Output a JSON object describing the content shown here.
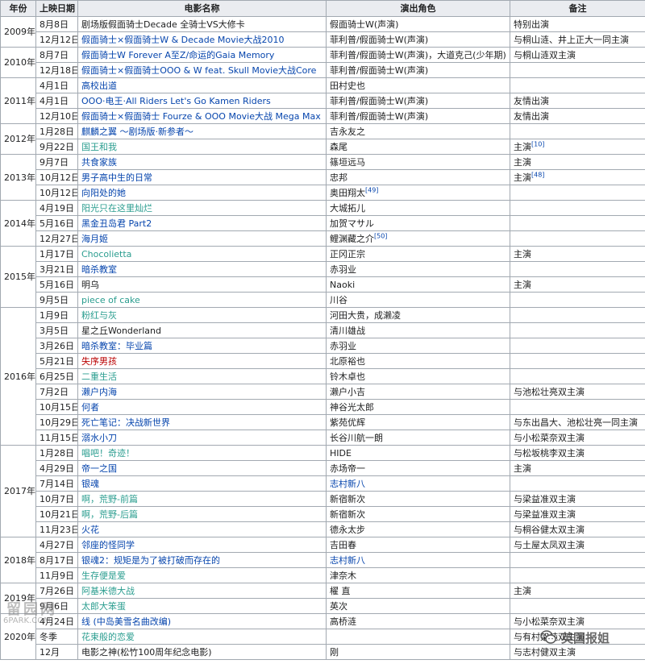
{
  "headers": [
    "年份",
    "上映日期",
    "电影名称",
    "演出角色",
    "备注"
  ],
  "years": [
    {
      "label": "2009年",
      "rows": [
        {
          "date": "8月8日",
          "title": "剧场版假面骑士Decade 全骑士VS大修卡",
          "title_style": "plain",
          "role": "假面骑士W(声演)",
          "note": "特别出演"
        },
        {
          "date": "12月12日",
          "title": "假面骑士×假面骑士W & Decade Movie大战2010",
          "title_style": "blue",
          "role": "菲利普/假面骑士W(声演)",
          "note": "与桐山涟、井上正大一同主演"
        }
      ]
    },
    {
      "label": "2010年",
      "rows": [
        {
          "date": "8月7日",
          "title": "假面骑士W Forever A至Z/命运的Gaia Memory",
          "title_style": "blue",
          "role": "菲利普/假面骑士W(声演)，大道克己(少年期)",
          "note": "与桐山涟双主演"
        },
        {
          "date": "12月18日",
          "title": "假面骑士×假面骑士OOO & W feat. Skull Movie大战Core",
          "title_style": "blue",
          "role": "菲利普/假面骑士W(声演)",
          "note": ""
        }
      ]
    },
    {
      "label": "2011年",
      "rows": [
        {
          "date": "4月1日",
          "title": "高校出道",
          "title_style": "blue",
          "role": "田村史也",
          "note": ""
        },
        {
          "date": "4月1日",
          "title": "OOO·电王·All Riders Let's Go Kamen Riders",
          "title_style": "blue",
          "role": "菲利普/假面骑士W(声演)",
          "note": "友情出演"
        },
        {
          "date": "12月10日",
          "title": "假面骑士×假面骑士 Fourze & OOO Movie大战 Mega Max",
          "title_style": "blue",
          "role": "菲利普/假面骑士W(声演)",
          "note": "友情出演"
        }
      ]
    },
    {
      "label": "2012年",
      "rows": [
        {
          "date": "1月28日",
          "title": "麒麟之翼 ～剧场版·新参者～",
          "title_style": "blue",
          "role": "吉永友之",
          "note": ""
        },
        {
          "date": "9月22日",
          "title": "国王和我",
          "title_style": "green",
          "role": "森尾",
          "note": "主演",
          "note_ref": "[10]"
        }
      ]
    },
    {
      "label": "2013年",
      "rows": [
        {
          "date": "9月7日",
          "title": "共食家族",
          "title_style": "blue",
          "role": "篠垣远马",
          "note": "主演"
        },
        {
          "date": "10月12日",
          "title": "男子高中生的日常",
          "title_style": "blue",
          "role": "忠邦",
          "note": "主演",
          "note_ref": "[48]"
        },
        {
          "date": "10月12日",
          "title": "向阳处的她",
          "title_style": "blue",
          "role": "奥田翔太",
          "role_ref": "[49]",
          "note": ""
        }
      ]
    },
    {
      "label": "2014年",
      "rows": [
        {
          "date": "4月19日",
          "title": "阳光只在这里灿烂",
          "title_style": "green",
          "role": "大城拓儿",
          "note": ""
        },
        {
          "date": "5月16日",
          "title": "黑金丑岛君 Part2",
          "title_style": "blue",
          "role": "加贺マサル",
          "note": ""
        },
        {
          "date": "12月27日",
          "title": "海月姬",
          "title_style": "blue",
          "role": "鲤渊藏之介",
          "role_ref": "[50]",
          "note": ""
        }
      ]
    },
    {
      "label": "2015年",
      "rows": [
        {
          "date": "1月17日",
          "title": "Chocolietta",
          "title_style": "green",
          "role": "正冈正宗",
          "note": "主演"
        },
        {
          "date": "3月21日",
          "title": "暗杀教室",
          "title_style": "blue",
          "role": "赤羽业",
          "note": ""
        },
        {
          "date": "5月16日",
          "title": "明乌",
          "title_style": "plain",
          "role": "Naoki",
          "note": "主演"
        },
        {
          "date": "9月5日",
          "title": "piece of cake",
          "title_style": "green",
          "role": "川谷",
          "note": ""
        }
      ]
    },
    {
      "label": "2016年",
      "rows": [
        {
          "date": "1月9日",
          "title": "粉红与灰",
          "title_style": "green",
          "role": "河田大贵，成濑凌",
          "note": ""
        },
        {
          "date": "3月5日",
          "title": "星之丘Wonderland",
          "title_style": "plain",
          "role": "清川雄战",
          "note": ""
        },
        {
          "date": "3月26日",
          "title": "暗杀教室：毕业篇",
          "title_style": "blue",
          "role": "赤羽业",
          "note": ""
        },
        {
          "date": "5月21日",
          "title": "失序男孩",
          "title_style": "red",
          "role": "北原裕也",
          "note": ""
        },
        {
          "date": "6月25日",
          "title": "二重生活",
          "title_style": "green",
          "role": "铃木卓也",
          "note": ""
        },
        {
          "date": "7月2日",
          "title": "濑户内海",
          "title_style": "blue",
          "role": "濑户小吉",
          "note": "与池松壮亮双主演"
        },
        {
          "date": "10月15日",
          "title": "何者",
          "title_style": "blue",
          "role": "神谷光太郎",
          "note": ""
        },
        {
          "date": "10月29日",
          "title": "死亡笔记：决战新世界",
          "title_style": "blue",
          "role": "紫苑优辉",
          "note": "与东出昌大、池松壮亮一同主演"
        },
        {
          "date": "11月15日",
          "title": "溺水小刀",
          "title_style": "blue",
          "role": "长谷川航一朗",
          "note": "与小松菜奈双主演"
        }
      ]
    },
    {
      "label": "2017年",
      "rows": [
        {
          "date": "1月28日",
          "title": "唱吧！奇迹！",
          "title_style": "green",
          "role": "HIDE",
          "note": "与松坂桃李双主演"
        },
        {
          "date": "4月29日",
          "title": "帝一之国",
          "title_style": "blue",
          "role": "赤场帝一",
          "note": "主演"
        },
        {
          "date": "7月14日",
          "title": "银魂",
          "title_style": "blue",
          "role": "志村新八",
          "role_style": "blue",
          "note": ""
        },
        {
          "date": "10月7日",
          "title": "啊，荒野-前篇",
          "title_style": "green",
          "role": "新宿新次",
          "note": "与梁益准双主演"
        },
        {
          "date": "10月21日",
          "title": "啊，荒野-后篇",
          "title_style": "green",
          "role": "新宿新次",
          "note": "与梁益准双主演"
        },
        {
          "date": "11月23日",
          "title": "火花",
          "title_style": "blue",
          "role": "德永太步",
          "note": "与桐谷健太双主演"
        }
      ]
    },
    {
      "label": "2018年",
      "rows": [
        {
          "date": "4月27日",
          "title": "邻座的怪同学",
          "title_style": "blue",
          "role": "吉田春",
          "note": "与土屋太凤双主演"
        },
        {
          "date": "8月17日",
          "title": "银魂2：规矩是为了被打破而存在的",
          "title_style": "blue",
          "role": "志村新八",
          "role_style": "blue",
          "note": ""
        },
        {
          "date": "11月9日",
          "title": "生存便是爱",
          "title_style": "green",
          "role": "津奈木",
          "note": ""
        }
      ]
    },
    {
      "label": "2019年",
      "rows": [
        {
          "date": "7月26日",
          "title": "阿基米德大战",
          "title_style": "green",
          "role": "櫂 直",
          "note": "主演"
        },
        {
          "date": "9月6日",
          "title": "太郎大笨蛋",
          "title_style": "green",
          "role": "英次",
          "note": ""
        }
      ]
    },
    {
      "label": "2020年",
      "rows": [
        {
          "date": "4月24日",
          "title": "线 (中岛美雪名曲改编)",
          "title_style": "blue",
          "role": "高桥涟",
          "note": "与小松菜奈双主演"
        },
        {
          "date": "冬季",
          "title": "花束般的恋爱",
          "title_style": "green",
          "role": "",
          "note": "与有村架纯双主演"
        },
        {
          "date": "12月",
          "title": "电影之神(松竹100周年纪念电影)",
          "title_style": "plain",
          "role": "刚",
          "note": "与志村健双主演"
        }
      ]
    }
  ],
  "watermark_left": {
    "line1": "留园网",
    "line2": "6PARK.COM"
  },
  "watermark_right": {
    "text": "英国报姐"
  }
}
